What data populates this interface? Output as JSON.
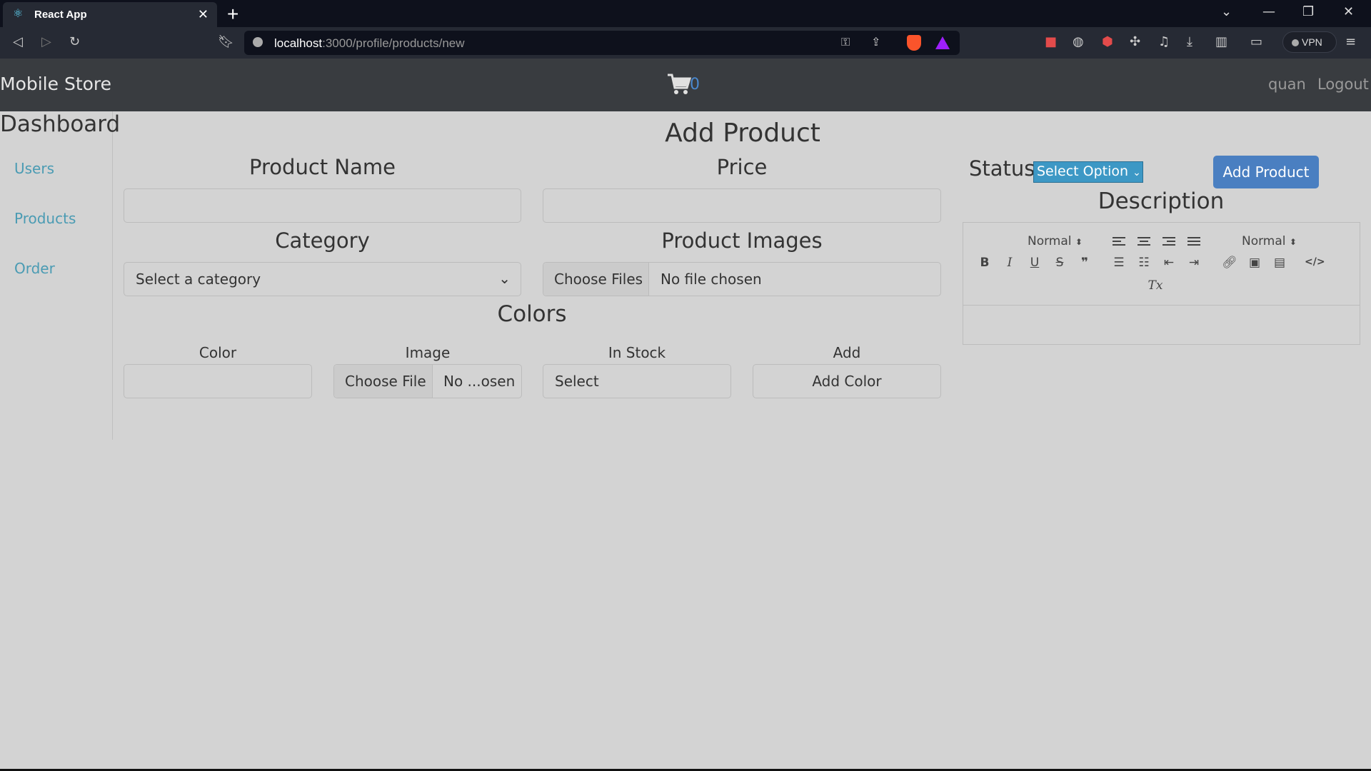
{
  "browser": {
    "tab_title": "React App",
    "tab_close": "✕",
    "new_tab": "+",
    "url_host": "localhost",
    "url_path": ":3000/profile/products/new",
    "vpn_label": "VPN"
  },
  "navbar": {
    "brand": "Mobile Store",
    "cart_count": "0",
    "user": "quan",
    "logout": "Logout"
  },
  "sidebar": {
    "title": "Dashboard",
    "links": [
      "Users",
      "Products",
      "Order"
    ]
  },
  "form": {
    "title": "Add Product",
    "product_name_label": "Product Name",
    "product_name_value": "",
    "price_label": "Price",
    "price_value": "",
    "category_label": "Category",
    "category_selected": "Select a category",
    "images_label": "Product Images",
    "images_button": "Choose Files",
    "images_status": "No file chosen",
    "colors_title": "Colors",
    "color_col_label": "Color",
    "color_value": "",
    "image_col_label": "Image",
    "image_button": "Choose File",
    "image_status": "No ...osen",
    "stock_col_label": "In Stock",
    "stock_selected": "Select",
    "add_col_label": "Add",
    "add_color_button": "Add Color",
    "status_label": "Status",
    "status_selected": "Select Option",
    "add_product_button": "Add Product",
    "description_label": "Description",
    "editor": {
      "header_select": "Normal",
      "size_select": "Normal",
      "bold": "B",
      "italic": "I",
      "underline": "U",
      "strike": "S",
      "quote": "❞",
      "clean": "Tx",
      "code": "</>"
    }
  },
  "colors": {
    "navbar_bg": "#393c40",
    "page_bg": "#d3d3d3",
    "link": "#4a9bb3",
    "primary_button": "#4a7fc1",
    "status_select_bg": "#3d98c5"
  }
}
